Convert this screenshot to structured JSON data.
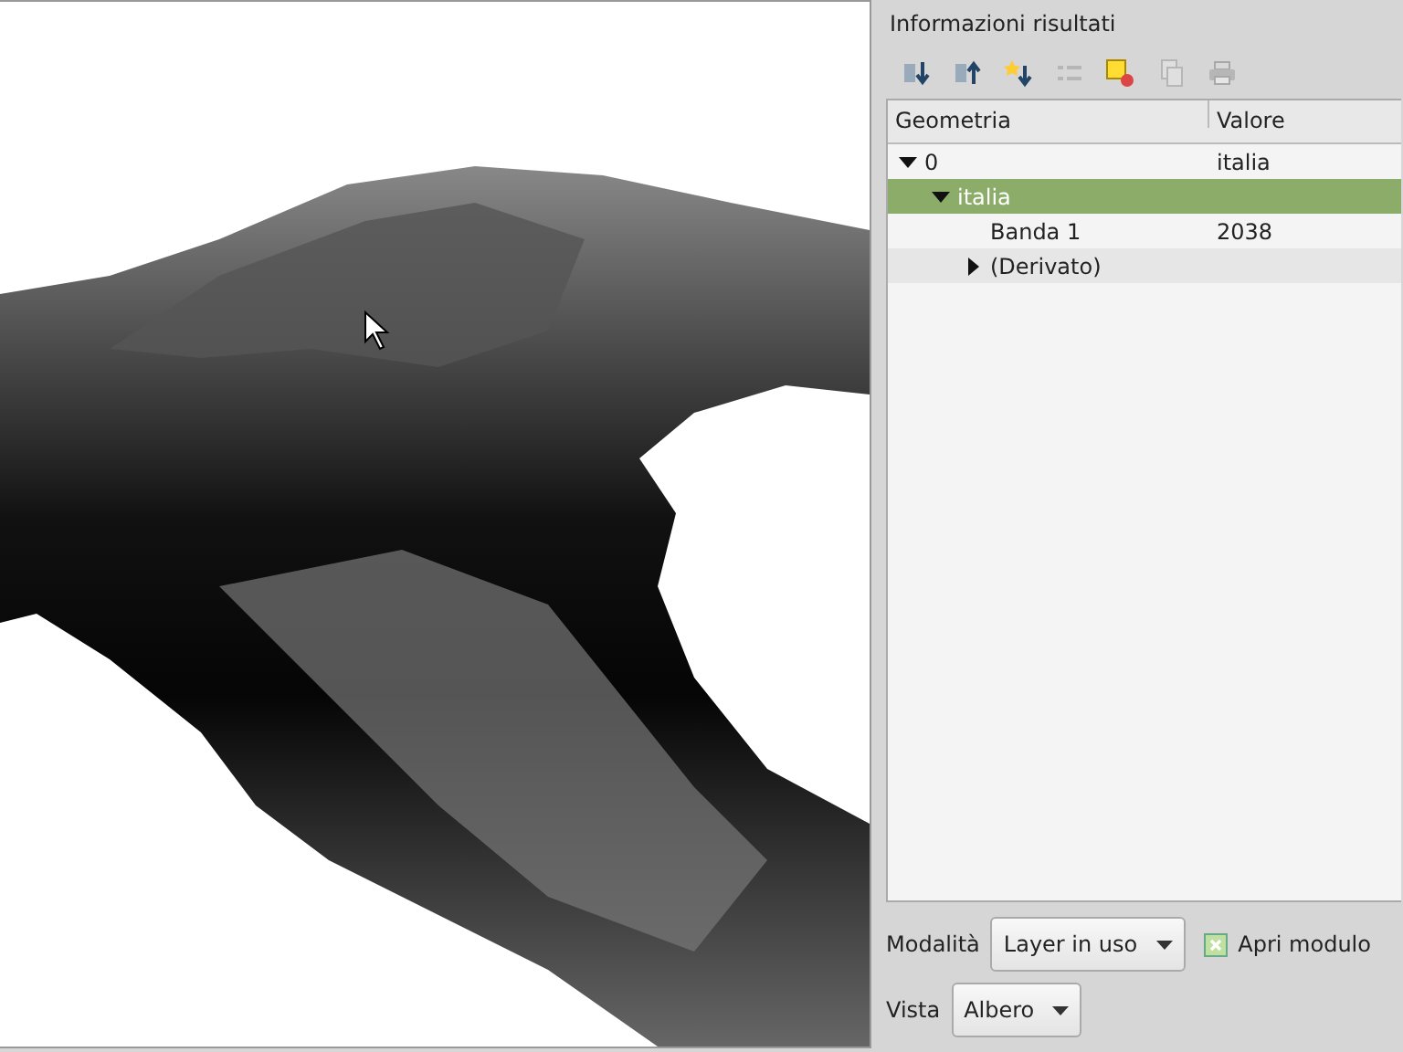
{
  "panel": {
    "title": "Informazioni risultati"
  },
  "toolbar": [
    {
      "kind": "expand",
      "disabled": false
    },
    {
      "kind": "collapse",
      "disabled": false
    },
    {
      "kind": "expand-new",
      "disabled": false
    },
    {
      "kind": "list",
      "disabled": true
    },
    {
      "kind": "highlight",
      "disabled": false
    },
    {
      "kind": "copy",
      "disabled": true
    },
    {
      "kind": "print",
      "disabled": true
    }
  ],
  "table": {
    "columns": [
      "Geometria",
      "Valore"
    ],
    "rows": [
      {
        "label": "0",
        "value": "italia",
        "expanded": true,
        "selected": false,
        "children": [
          {
            "label": "italia",
            "expanded": true,
            "selected": true,
            "children": [
              {
                "label": "Banda 1",
                "value": "2038",
                "selected": false
              },
              {
                "label": "(Derivato)",
                "expanded": false,
                "selected": false
              }
            ]
          }
        ]
      }
    ]
  },
  "mode": {
    "label": "Modalità",
    "value": "Layer in uso"
  },
  "open_form": {
    "label": "Apri modulo",
    "checked": true
  },
  "view": {
    "label": "Vista",
    "value": "Albero"
  }
}
